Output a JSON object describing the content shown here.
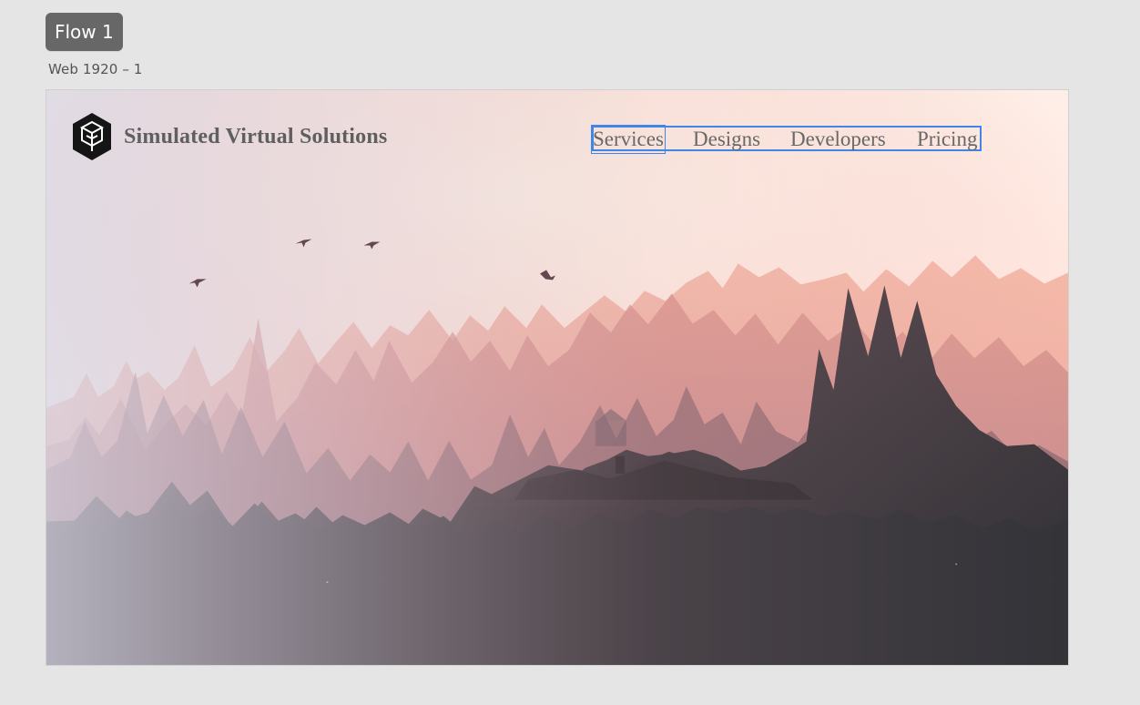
{
  "workspace": {
    "flow_label": "Flow 1",
    "artboard_title": "Web 1920 – 1"
  },
  "site": {
    "brand_name": "Simulated Virtual Solutions",
    "logo_icon": "hexagon-cube-icon",
    "nav": [
      {
        "label": "Services",
        "selected": true
      },
      {
        "label": "Designs",
        "selected": false
      },
      {
        "label": "Developers",
        "selected": false
      },
      {
        "label": "Pricing",
        "selected": false
      }
    ]
  },
  "colors": {
    "canvas": "#e5e5e5",
    "flow_badge": "#676767",
    "selection": "#3f87e7",
    "brand_text": "#5f5f5f",
    "nav_text": "#686868"
  }
}
